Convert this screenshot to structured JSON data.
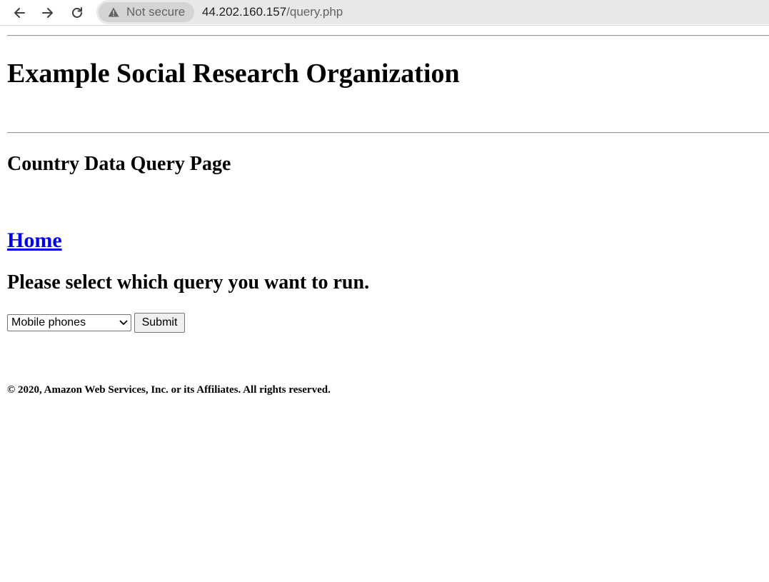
{
  "browser": {
    "security_label": "Not secure",
    "url_host": "44.202.160.157",
    "url_path": "/query.php"
  },
  "page": {
    "org_title": "Example Social Research Organization",
    "page_title": "Country Data Query Page",
    "home_link": "Home",
    "prompt": "Please select which query you want to run.",
    "query_select": {
      "selected": "Mobile phones"
    },
    "submit_label": "Submit",
    "footer": "© 2020, Amazon Web Services, Inc. or its Affiliates. All rights reserved."
  },
  "colors": {
    "link": "#0000ee",
    "chrome_bg": "#e8e8e8"
  }
}
